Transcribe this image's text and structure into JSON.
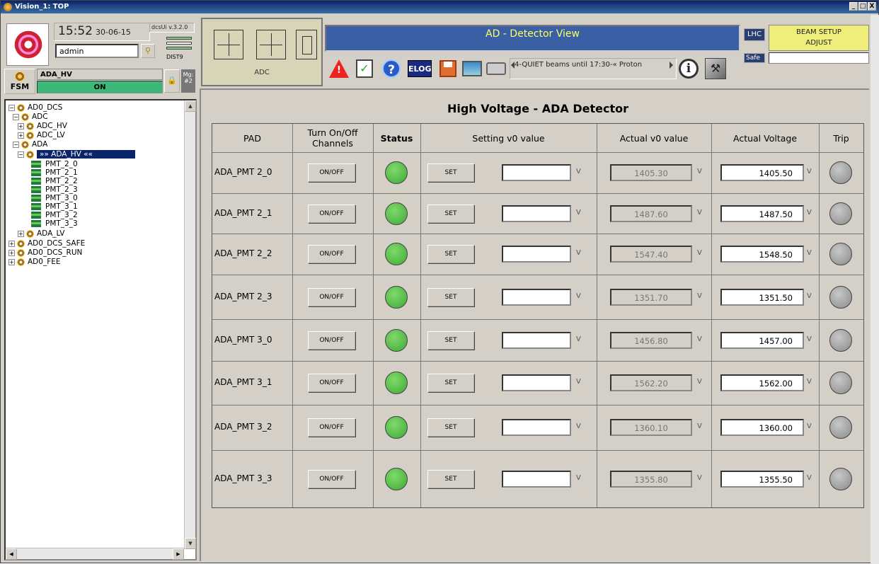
{
  "window": {
    "title": "Vision_1: TOP",
    "min": "_",
    "max": "□",
    "close": "X"
  },
  "session": {
    "time": "15:52",
    "date": "30-06-15",
    "version": "dcsUi v.3.2.0",
    "user": "admin",
    "dist": "DIST9"
  },
  "fsm": {
    "label": "FSM",
    "node": "ADA_HV",
    "state": "ON",
    "mg": "Mg:",
    "mg_num": "#2"
  },
  "tree": {
    "items": [
      {
        "label": "AD0_DCS",
        "toggle": "−",
        "icon": "gear"
      },
      {
        "label": "ADC",
        "toggle": "−",
        "icon": "gear"
      },
      {
        "label": "ADC_HV",
        "toggle": "+",
        "icon": "gear"
      },
      {
        "label": "ADC_LV",
        "toggle": "+",
        "icon": "gear"
      },
      {
        "label": "ADA",
        "toggle": "−",
        "icon": "gear"
      },
      {
        "label": "»» ADA_HV ««",
        "toggle": "−",
        "icon": "gear",
        "selected": true
      },
      {
        "label": "PMT_2_0",
        "icon": "module"
      },
      {
        "label": "PMT_2_1",
        "icon": "module"
      },
      {
        "label": "PMT_2_2",
        "icon": "module"
      },
      {
        "label": "PMT_2_3",
        "icon": "module"
      },
      {
        "label": "PMT_3_0",
        "icon": "module"
      },
      {
        "label": "PMT_3_1",
        "icon": "module"
      },
      {
        "label": "PMT_3_2",
        "icon": "module"
      },
      {
        "label": "PMT_3_3",
        "icon": "module"
      },
      {
        "label": "ADA_LV",
        "toggle": "+",
        "icon": "gear"
      },
      {
        "label": "AD0_DCS_SAFE",
        "toggle": "+",
        "icon": "gear"
      },
      {
        "label": "AD0_DCS_RUN",
        "toggle": "+",
        "icon": "gear"
      },
      {
        "label": "AD0_FEE",
        "toggle": "+",
        "icon": "gear"
      }
    ]
  },
  "adc_panel": {
    "label": "ADC"
  },
  "header": {
    "title": "AD - Detector View",
    "ticker": "4-QUIET beams until 17:30-«   Proton",
    "elog": "ELOG",
    "lhc": "LHC",
    "safe": "Safe",
    "beam_line1": "BEAM SETUP",
    "beam_line2": "ADJUST"
  },
  "panel": {
    "title": "High Voltage - ADA Detector",
    "columns": {
      "pad": "PAD",
      "onoff": "Turn On/Off Channels",
      "status": "Status",
      "setting": "Setting v0 value",
      "actual_v0": "Actual v0 value",
      "actual_voltage": "Actual Voltage",
      "trip": "Trip"
    },
    "onoff_label": "ON/OFF",
    "set_label": "SET",
    "unit": "V",
    "rows": [
      {
        "pad": "ADA_PMT 2_0",
        "status": "on",
        "setting": "",
        "actual_v0": "1405.30",
        "actual_voltage": "1405.50",
        "trip": "off"
      },
      {
        "pad": "ADA_PMT 2_1",
        "status": "on",
        "setting": "",
        "actual_v0": "1487.60",
        "actual_voltage": "1487.50",
        "trip": "off"
      },
      {
        "pad": "ADA_PMT 2_2",
        "status": "on",
        "setting": "",
        "actual_v0": "1547.40",
        "actual_voltage": "1548.50",
        "trip": "off"
      },
      {
        "pad": "ADA_PMT 2_3",
        "status": "on",
        "setting": "",
        "actual_v0": "1351.70",
        "actual_voltage": "1351.50",
        "trip": "off"
      },
      {
        "pad": "ADA_PMT 3_0",
        "status": "on",
        "setting": "",
        "actual_v0": "1456.80",
        "actual_voltage": "1457.00",
        "trip": "off"
      },
      {
        "pad": "ADA_PMT 3_1",
        "status": "on",
        "setting": "",
        "actual_v0": "1562.20",
        "actual_voltage": "1562.00",
        "trip": "off"
      },
      {
        "pad": "ADA_PMT 3_2",
        "status": "on",
        "setting": "",
        "actual_v0": "1360.10",
        "actual_voltage": "1360.00",
        "trip": "off"
      },
      {
        "pad": "ADA_PMT 3_3",
        "status": "on",
        "setting": "",
        "actual_v0": "1355.80",
        "actual_voltage": "1355.50",
        "trip": "off"
      }
    ]
  },
  "colors": {
    "status_on": "#3faa36",
    "trip_off": "#8a8a8a",
    "fsm_on": "#3cb878",
    "header_bg": "#3a5fa5",
    "header_text": "#ffff66",
    "beam_bg": "#f0ee7a"
  }
}
